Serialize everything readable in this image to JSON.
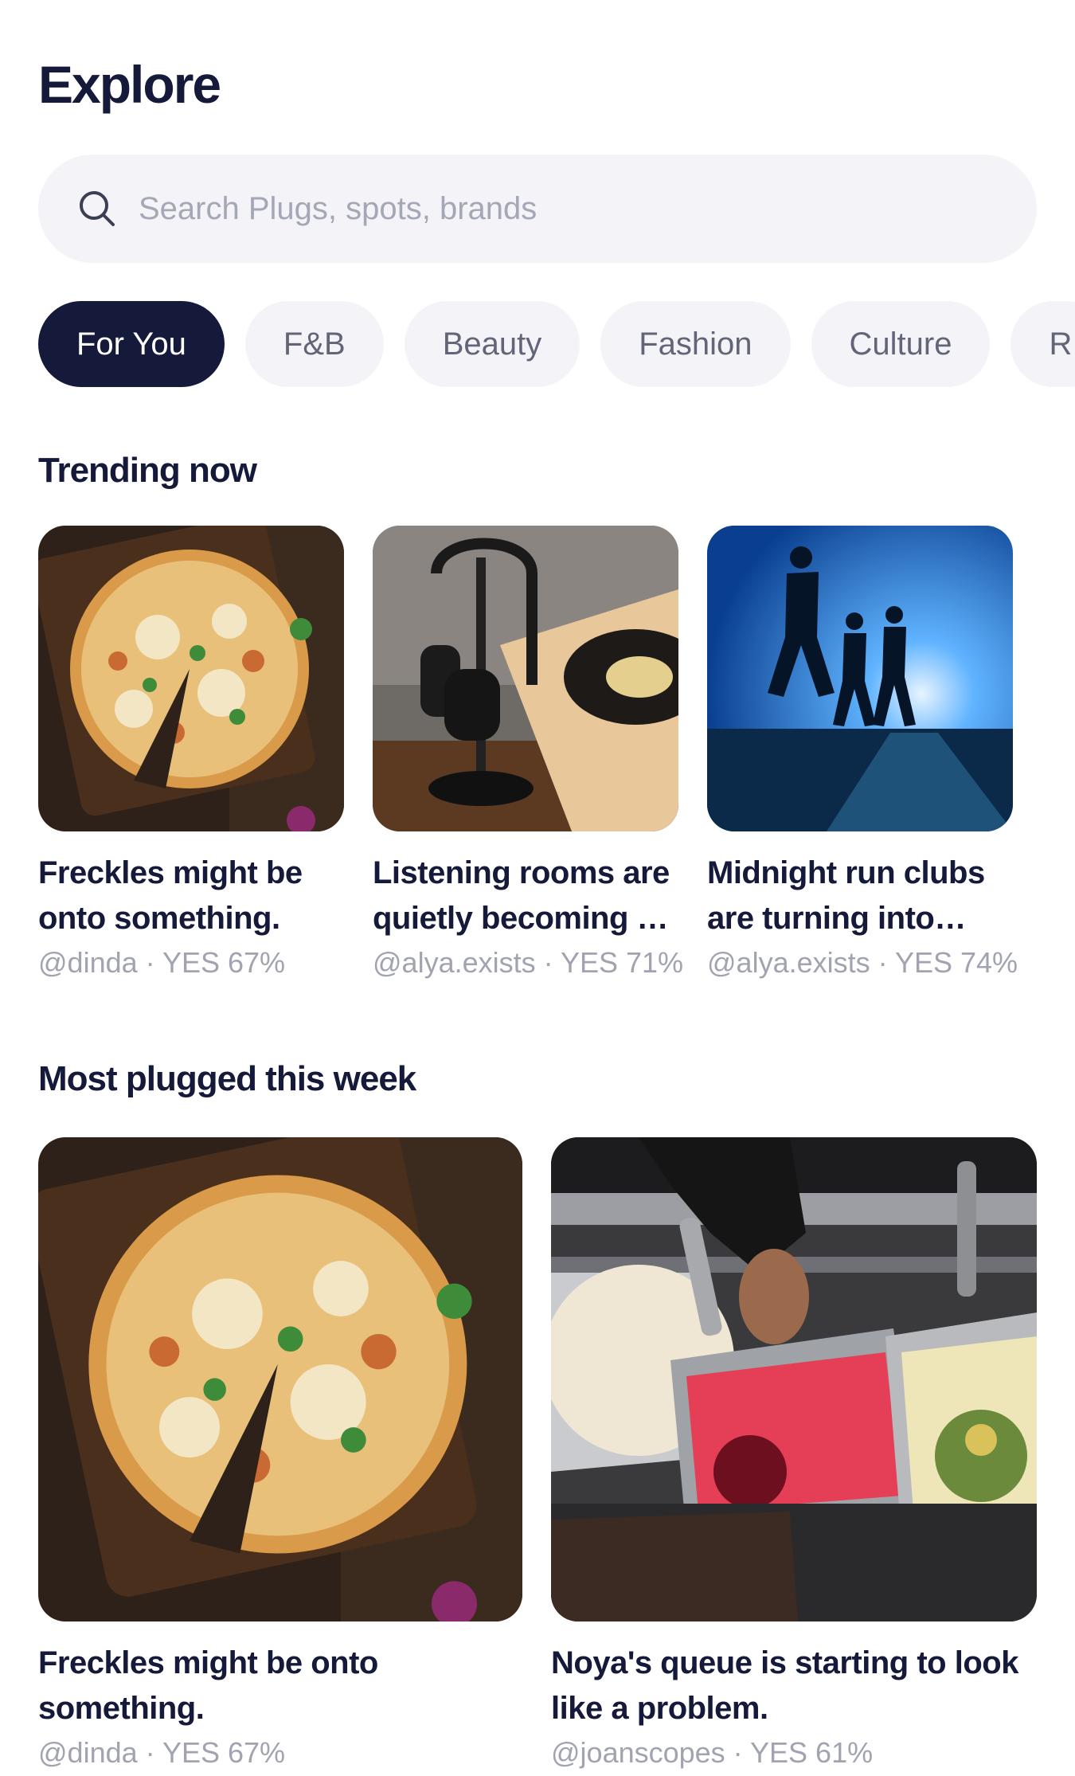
{
  "page": {
    "title": "Explore"
  },
  "search": {
    "placeholder": "Search Plugs, spots, brands",
    "icon": "search-icon"
  },
  "filters": [
    {
      "label": "For You",
      "active": true
    },
    {
      "label": "F&B",
      "active": false
    },
    {
      "label": "Beauty",
      "active": false
    },
    {
      "label": "Fashion",
      "active": false
    },
    {
      "label": "Culture",
      "active": false
    },
    {
      "label": "R",
      "active": false
    }
  ],
  "trending": {
    "title": "Trending now",
    "cards": [
      {
        "title": "Freckles might be onto something.",
        "meta": "@dinda · YES 67%"
      },
      {
        "title": "Listening rooms are quietly becoming …",
        "meta": "@alya.exists · YES 71%"
      },
      {
        "title": "Midnight run clubs are turning into…",
        "meta": "@alya.exists · YES 74%"
      }
    ]
  },
  "most_plugged": {
    "title": "Most plugged this week",
    "cards": [
      {
        "title": "Freckles might be onto something.",
        "meta": "@dinda · YES 67%"
      },
      {
        "title": "Noya's queue is starting to look like a problem.",
        "meta": "@joanscopes · YES 61%"
      }
    ]
  },
  "colors": {
    "primary": "#151a3b",
    "chip_bg": "#f4f4f8",
    "muted": "#a1a3b0"
  }
}
